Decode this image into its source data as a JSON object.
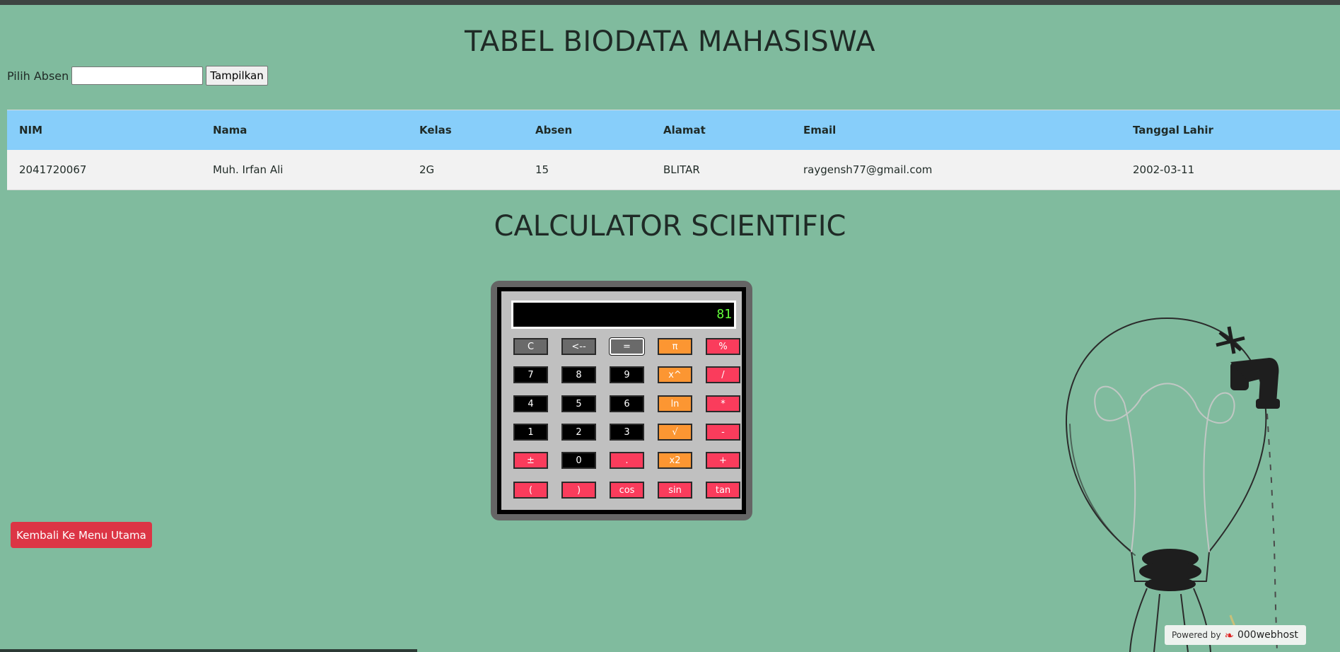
{
  "page": {
    "title": "TABEL BIODATA MAHASISWA",
    "calc_title": "CALCULATOR SCIENTIFIC"
  },
  "form": {
    "label": "Pilih Absen",
    "input_value": "",
    "button_label": "Tampilkan"
  },
  "table": {
    "headers": [
      "NIM",
      "Nama",
      "Kelas",
      "Absen",
      "Alamat",
      "Email",
      "Tanggal Lahir"
    ],
    "rows": [
      [
        "2041720067",
        "Muh. Irfan Ali",
        "2G",
        "15",
        "BLITAR",
        "raygensh77@gmail.com",
        "2002-03-11"
      ]
    ]
  },
  "calculator": {
    "display": "81",
    "keys": [
      [
        "C",
        "<--",
        "=",
        "π",
        "%"
      ],
      [
        "7",
        "8",
        "9",
        "x^",
        "/"
      ],
      [
        "4",
        "5",
        "6",
        "ln",
        "*"
      ],
      [
        "1",
        "2",
        "3",
        "√",
        "-"
      ],
      [
        "±",
        "0",
        ".",
        "x2",
        "+"
      ],
      [
        "(",
        ")",
        "cos",
        "sin",
        "tan"
      ]
    ]
  },
  "back_button": "Kembali Ke Menu Utama",
  "footer": {
    "powered_label": "Powered by",
    "brand": "000webhost"
  },
  "colors": {
    "background": "#80bb9e",
    "table_header": "#87cefa",
    "back_button": "#dc3545",
    "key_orange": "#fc9632",
    "key_red": "#fa3c5c",
    "display_text": "#63ff3a"
  }
}
